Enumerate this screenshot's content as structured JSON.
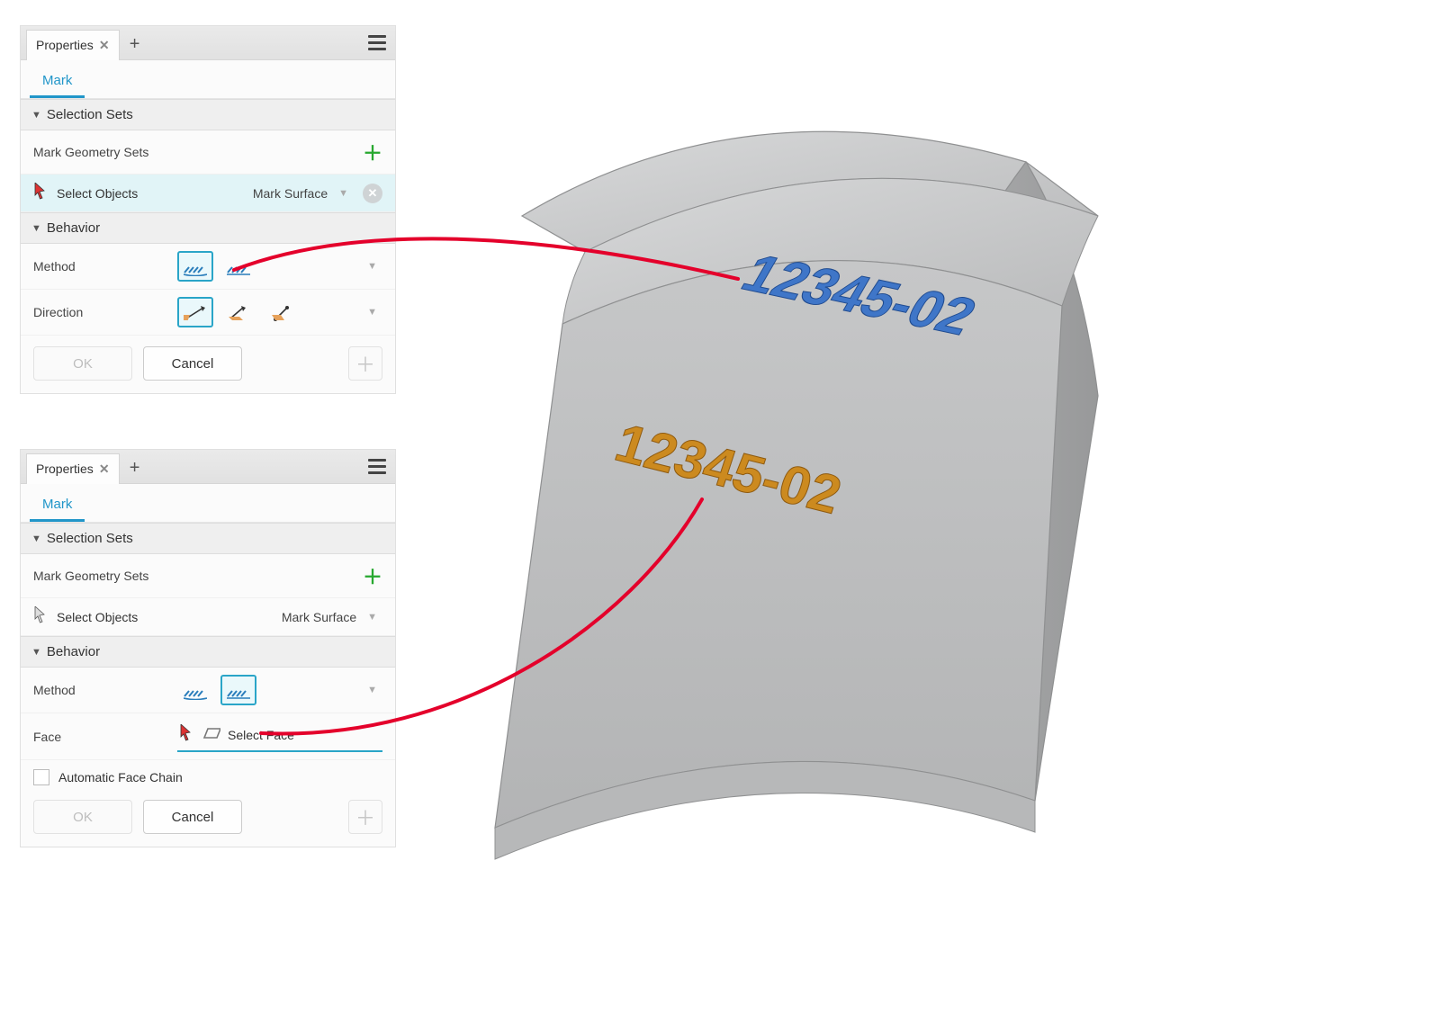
{
  "panel": {
    "title": "Properties",
    "breadcrumb": "Mark"
  },
  "sections": {
    "selection_sets": "Selection Sets",
    "behavior": "Behavior"
  },
  "labels": {
    "mark_geometry_sets": "Mark Geometry Sets",
    "select_objects": "Select Objects",
    "mark_surface": "Mark Surface",
    "method": "Method",
    "direction": "Direction",
    "face": "Face",
    "select_face": "Select Face",
    "auto_face_chain": "Automatic Face Chain"
  },
  "buttons": {
    "ok": "OK",
    "cancel": "Cancel"
  },
  "panel1": {
    "method_selected_index": 0,
    "direction_selected_index": 0,
    "select_objects_active": true
  },
  "panel2": {
    "method_selected_index": 1,
    "select_objects_active": false,
    "auto_face_chain_checked": false
  },
  "viewport": {
    "mark_text_top": "12345-02",
    "mark_text_front": "12345-02",
    "color_top": "#3f76c8",
    "color_front": "#cc8a1f"
  },
  "icons": {
    "method_surface": "wrap-on-surface-icon",
    "method_project": "project-to-face-icon",
    "direction_normal": "direction-normal-icon",
    "direction_along": "direction-along-icon",
    "direction_custom": "direction-custom-icon"
  }
}
